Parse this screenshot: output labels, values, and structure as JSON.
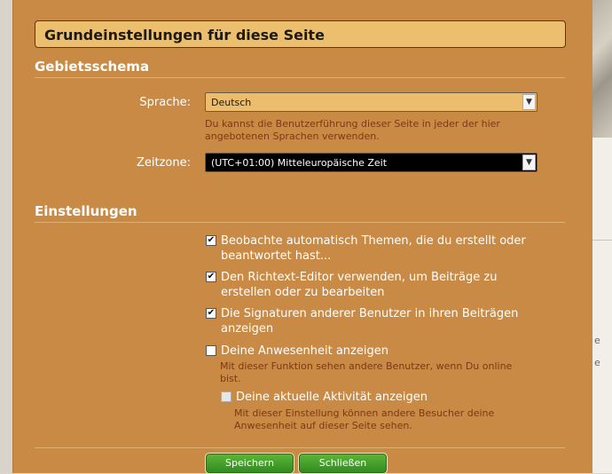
{
  "dialog": {
    "title": "Grundeinstellungen für diese Seite"
  },
  "locale": {
    "heading": "Gebietsschema",
    "language_label": "Sprache:",
    "language_value": "Deutsch",
    "language_hint": "Du kannst die Benutzerführung dieser Seite in jeder der hier angebotenen Sprachen verwenden.",
    "timezone_label": "Zeitzone:",
    "timezone_value": "(UTC+01:00) Mitteleuropäische Zeit"
  },
  "settings": {
    "heading": "Einstellungen",
    "options": [
      {
        "label": "Beobachte automatisch Themen, die du erstellt oder beantwortet hast...",
        "checked": true
      },
      {
        "label": "Den Richtext-Editor verwenden, um Beiträge zu erstellen oder zu bearbeiten",
        "checked": true
      },
      {
        "label": "Die Signaturen anderer Benutzer in ihren Beiträgen anzeigen",
        "checked": true
      },
      {
        "label": "Deine Anwesenheit anzeigen",
        "checked": false,
        "hint": "Mit dieser Funktion sehen andere Benutzer, wenn Du online bist."
      },
      {
        "label": "Deine aktuelle Aktivität anzeigen",
        "checked": false,
        "disabled": true,
        "hint": "Mit dieser Einstellung können andere Besucher deine Anwesenheit auf dieser Seite sehen."
      }
    ]
  },
  "buttons": {
    "save": "Speichern",
    "close": "Schließen"
  },
  "colors": {
    "dialog_bg": "#c88a44",
    "title_bg": "#ebbf6d",
    "hint_text": "#7a3a15",
    "button_green": "#3f9a26"
  },
  "background": {
    "mark_1": "e",
    "mark_2": "e"
  }
}
